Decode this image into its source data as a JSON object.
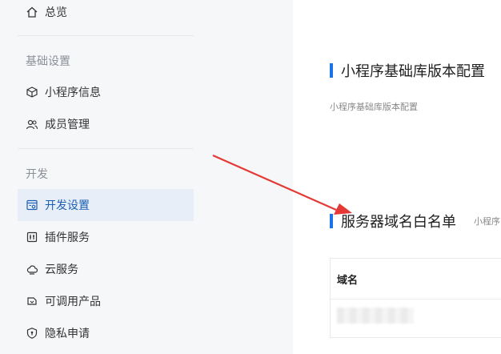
{
  "sidebar": {
    "overview_label": "总览",
    "group_basic": "基础设置",
    "mini_program_info": "小程序信息",
    "member_management": "成员管理",
    "group_dev": "开发",
    "dev_settings": "开发设置",
    "plugin_service": "插件服务",
    "cloud_service": "云服务",
    "callable_products": "可调用产品",
    "privacy_application": "隐私申请"
  },
  "main": {
    "section1_title": "小程序基础库版本配置",
    "section1_desc": "小程序基础库版本配置",
    "section2_title": "服务器域名白名单",
    "section2_desc": "小程序",
    "table": {
      "column_domain": "域名"
    }
  },
  "colors": {
    "accent": "#1a73e8",
    "active_bg": "#e7eef8",
    "annotation_arrow": "#e53935"
  },
  "icons": {
    "overview": "home-icon",
    "mini_program_info": "cube-icon",
    "member_management": "users-icon",
    "dev_settings": "settings-window-icon",
    "plugin_service": "plugin-icon",
    "cloud_service": "cloud-icon",
    "callable_products": "api-icon",
    "privacy_application": "shield-icon"
  }
}
